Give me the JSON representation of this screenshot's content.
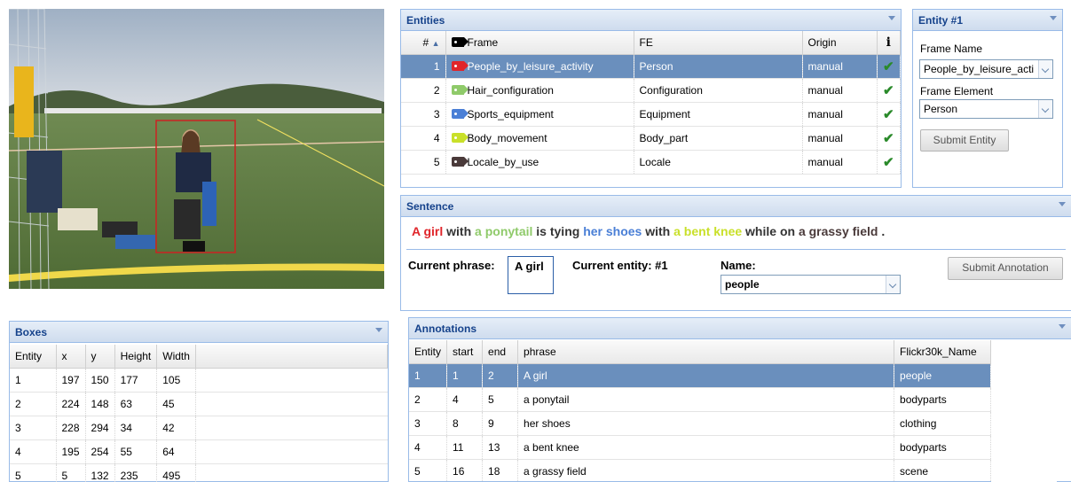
{
  "colors": {
    "accent_blue": "#15428b",
    "selected_row": "#6a8fbd",
    "check_green": "#2a8a2a",
    "bbox_red": "#cc2222"
  },
  "boxes": {
    "title": "Boxes",
    "columns": [
      "Entity",
      "x",
      "y",
      "Height",
      "Width"
    ],
    "rows": [
      [
        "1",
        "197",
        "150",
        "177",
        "105"
      ],
      [
        "2",
        "224",
        "148",
        "63",
        "45"
      ],
      [
        "3",
        "228",
        "294",
        "34",
        "42"
      ],
      [
        "4",
        "195",
        "254",
        "55",
        "64"
      ],
      [
        "5",
        "5",
        "132",
        "235",
        "495"
      ]
    ]
  },
  "entities": {
    "title": "Entities",
    "columns": [
      "#",
      "Frame",
      "FE",
      "Origin",
      "i"
    ],
    "rows": [
      {
        "num": "1",
        "frame": "People_by_leisure_activity",
        "fe": "Person",
        "origin": "manual",
        "tag_color": "#e0252a",
        "selected": true
      },
      {
        "num": "2",
        "frame": "Hair_configuration",
        "fe": "Configuration",
        "origin": "manual",
        "tag_color": "#8fca6a",
        "selected": false
      },
      {
        "num": "3",
        "frame": "Sports_equipment",
        "fe": "Equipment",
        "origin": "manual",
        "tag_color": "#4a7fd6",
        "selected": false
      },
      {
        "num": "4",
        "frame": "Body_movement",
        "fe": "Body_part",
        "origin": "manual",
        "tag_color": "#c9e02a",
        "selected": false
      },
      {
        "num": "5",
        "frame": "Locale_by_use",
        "fe": "Locale",
        "origin": "manual",
        "tag_color": "#4a3a3a",
        "selected": false
      }
    ]
  },
  "entity_form": {
    "title": "Entity #1",
    "frame_name_label": "Frame Name",
    "frame_name_value": "People_by_leisure_acti",
    "frame_element_label": "Frame Element",
    "frame_element_value": "Person",
    "submit_label": "Submit Entity"
  },
  "sentence": {
    "title": "Sentence",
    "parts": [
      {
        "text": "A girl",
        "color": "#e0252a"
      },
      {
        "text": " with ",
        "color": "#333333"
      },
      {
        "text": "a ponytail",
        "color": "#8fca6a"
      },
      {
        "text": " is tying ",
        "color": "#333333"
      },
      {
        "text": "her shoes",
        "color": "#4a7fd6"
      },
      {
        "text": " with ",
        "color": "#333333"
      },
      {
        "text": "a bent knee",
        "color": "#c9e02a"
      },
      {
        "text": " while on ",
        "color": "#333333"
      },
      {
        "text": "a grassy field",
        "color": "#4a3a3a"
      },
      {
        "text": " .",
        "color": "#333333"
      }
    ],
    "current_phrase_label": "Current phrase:",
    "current_phrase_value": "A girl",
    "current_entity_label": "Current entity: #1",
    "name_label": "Name:",
    "name_value": "people",
    "submit_label": "Submit Annotation"
  },
  "annotations": {
    "title": "Annotations",
    "columns": [
      "Entity",
      "start",
      "end",
      "phrase",
      "Flickr30k_Name"
    ],
    "rows": [
      {
        "cells": [
          "1",
          "1",
          "2",
          "A girl",
          "people"
        ],
        "selected": true
      },
      {
        "cells": [
          "2",
          "4",
          "5",
          "a ponytail",
          "bodyparts"
        ],
        "selected": false
      },
      {
        "cells": [
          "3",
          "8",
          "9",
          "her shoes",
          "clothing"
        ],
        "selected": false
      },
      {
        "cells": [
          "4",
          "11",
          "13",
          "a bent knee",
          "bodyparts"
        ],
        "selected": false
      },
      {
        "cells": [
          "5",
          "16",
          "18",
          "a grassy field",
          "scene"
        ],
        "selected": false
      }
    ]
  }
}
